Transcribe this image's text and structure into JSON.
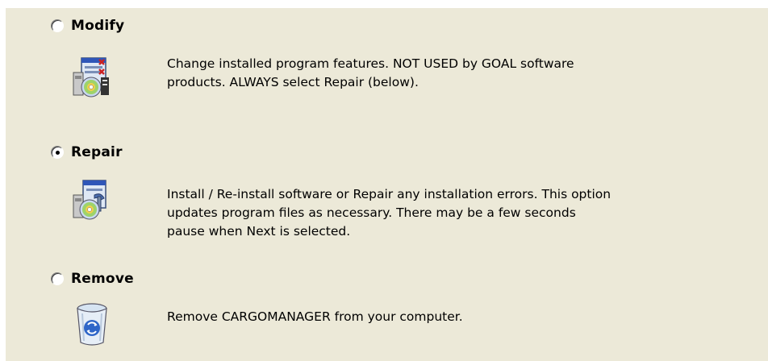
{
  "options": [
    {
      "label": "Modify",
      "selected": false,
      "icon": "modify-installer-icon",
      "description": "Change installed program features. NOT USED by GOAL software\nproducts. ALWAYS select Repair (below)."
    },
    {
      "label": "Repair",
      "selected": true,
      "icon": "repair-installer-icon",
      "description": "Install / Re-install software or Repair any installation errors. This option\nupdates program files as necessary. There may be a few seconds\npause when Next is selected."
    },
    {
      "label": "Remove",
      "selected": false,
      "icon": "recycle-bin-icon",
      "description": "Remove CARGOMANAGER from your computer."
    }
  ],
  "colors": {
    "panel_background": "#ece9d8",
    "page_background": "#ffffff"
  }
}
